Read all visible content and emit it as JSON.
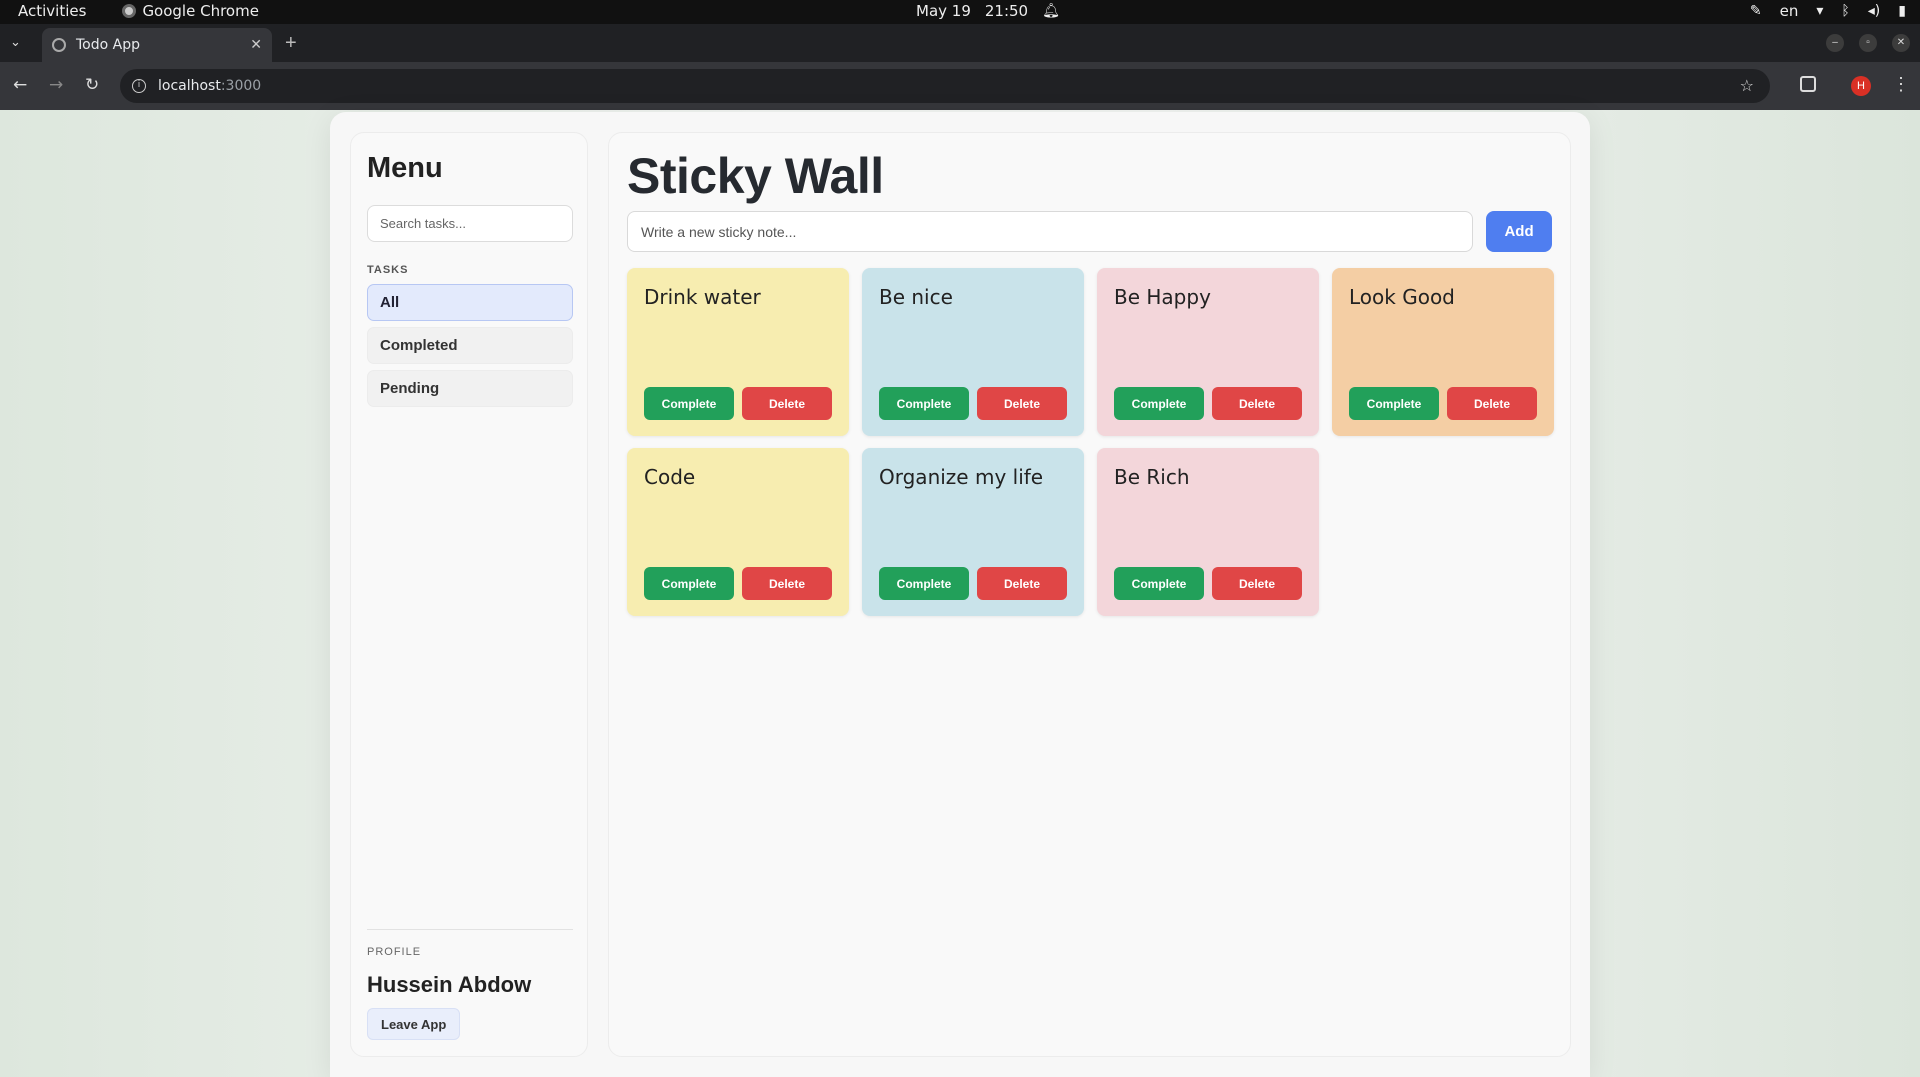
{
  "os": {
    "activities": "Activities",
    "app_name": "Google Chrome",
    "date": "May 19",
    "time": "21:50",
    "lang": "en"
  },
  "browser": {
    "tab_title": "Todo App",
    "url_host": "localhost",
    "url_port": ":3000",
    "avatar_letter": "H"
  },
  "sidebar": {
    "title": "Menu",
    "search_placeholder": "Search tasks...",
    "tasks_label": "TASKS",
    "items": [
      {
        "label": "All",
        "active": true
      },
      {
        "label": "Completed",
        "active": false
      },
      {
        "label": "Pending",
        "active": false
      }
    ],
    "profile_label": "PROFILE",
    "profile_name": "Hussein Abdow",
    "leave_label": "Leave App"
  },
  "main": {
    "title": "Sticky Wall",
    "input_placeholder": "Write a new sticky note...",
    "add_label": "Add",
    "complete_label": "Complete",
    "delete_label": "Delete",
    "notes": [
      {
        "title": "Drink water",
        "color": "#f7edb0"
      },
      {
        "title": "Be nice",
        "color": "#c9e3ea"
      },
      {
        "title": "Be Happy",
        "color": "#f3d6da"
      },
      {
        "title": "Look Good",
        "color": "#f4cea4"
      },
      {
        "title": "Code",
        "color": "#f7edb0"
      },
      {
        "title": "Organize my life",
        "color": "#c9e3ea"
      },
      {
        "title": "Be Rich",
        "color": "#f3d6da"
      }
    ]
  }
}
